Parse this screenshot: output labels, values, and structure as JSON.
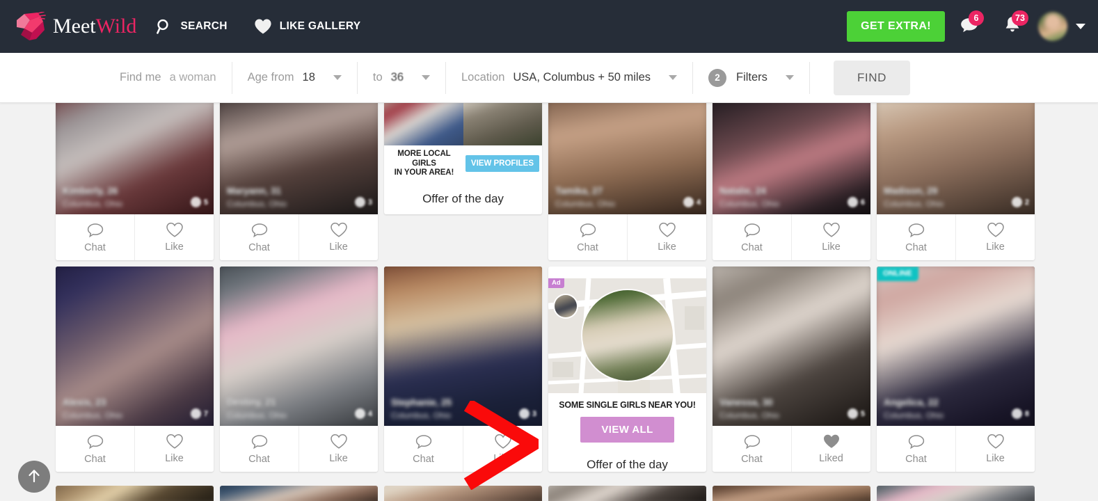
{
  "brand": {
    "name_part1": "Meet",
    "name_part2": "Wild",
    "logo_icon": "meetwild-heart-logo"
  },
  "header": {
    "nav": [
      {
        "label": "SEARCH",
        "icon": "search-icon"
      },
      {
        "label": "LIKE GALLERY",
        "icon": "heart-icon"
      }
    ],
    "get_extra_label": "GET EXTRA!",
    "messages": {
      "icon": "chat-bubble-icon",
      "badge": "6"
    },
    "notifications": {
      "icon": "bell-icon",
      "badge": "73"
    },
    "account": {
      "avatar": "user-avatar",
      "caret": "chevron-down-icon"
    },
    "accent_green": "#4cd137",
    "accent_pink": "#ec2563",
    "background": "#262d38"
  },
  "searchbar": {
    "find_me": {
      "label": "Find me",
      "value": "a woman"
    },
    "age_from": {
      "label": "Age from",
      "value": "18"
    },
    "age_to": {
      "label": "to",
      "value": "36"
    },
    "location": {
      "label": "Location",
      "value": "USA, Columbus + 50 miles"
    },
    "filters": {
      "count": "2",
      "label": "Filters"
    },
    "find_button": "FIND"
  },
  "gallery": {
    "actions": {
      "chat": "Chat",
      "like": "Like",
      "liked": "Liked"
    },
    "cards": [
      {
        "row": 1,
        "type": "profile",
        "liked": false,
        "badge": null,
        "gradient": "g1"
      },
      {
        "row": 1,
        "type": "profile",
        "liked": false,
        "badge": null,
        "gradient": "g2"
      },
      {
        "row": 1,
        "type": "ad_duo"
      },
      {
        "row": 1,
        "type": "profile",
        "liked": false,
        "badge": null,
        "gradient": "g3"
      },
      {
        "row": 1,
        "type": "profile",
        "liked": false,
        "badge": null,
        "gradient": "g4"
      },
      {
        "row": 1,
        "type": "profile",
        "liked": false,
        "badge": null,
        "gradient": "g5"
      },
      {
        "row": 2,
        "type": "profile",
        "liked": false,
        "badge": null,
        "gradient": "g6"
      },
      {
        "row": 2,
        "type": "profile",
        "liked": false,
        "badge": null,
        "gradient": "g7"
      },
      {
        "row": 2,
        "type": "profile",
        "liked": false,
        "badge": null,
        "gradient": "g8"
      },
      {
        "row": 2,
        "type": "ad_map"
      },
      {
        "row": 2,
        "type": "profile",
        "liked": true,
        "badge": null,
        "gradient": "g9"
      },
      {
        "row": 2,
        "type": "profile",
        "liked": false,
        "badge": "ONLINE",
        "gradient": "g10"
      }
    ],
    "ad_duo": {
      "headline": "MORE LOCAL GIRLS IN YOUR AREA!",
      "headline_line1": "MORE LOCAL GIRLS",
      "headline_line2": "IN YOUR AREA!",
      "cta": "VIEW PROFILES",
      "footer": "Offer of the day",
      "cta_color": "#63c3e8"
    },
    "ad_map": {
      "ad_tag": "Ad",
      "headline": "SOME SINGLE GIRLS NEAR YOU!",
      "cta": "VIEW ALL",
      "footer": "Offer of the day",
      "cta_color": "#d18ed0"
    },
    "annotation": {
      "type": "red-chevron-pointer",
      "color": "#fa0a0a"
    },
    "scroll_top_button": {
      "icon": "arrow-up-icon"
    }
  }
}
